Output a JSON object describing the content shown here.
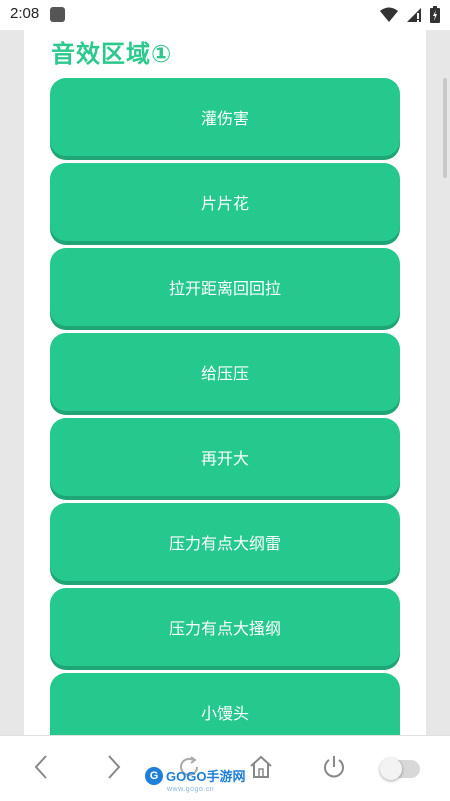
{
  "status_bar": {
    "time": "2:08",
    "icons": [
      "app-notification-icon",
      "wifi-icon",
      "signal-icon",
      "battery-icon"
    ]
  },
  "page": {
    "section_title": "音效区域①",
    "buttons": [
      {
        "label": "灌伤害"
      },
      {
        "label": "片片花"
      },
      {
        "label": "拉开距离回回拉"
      },
      {
        "label": "给压压"
      },
      {
        "label": "再开大"
      },
      {
        "label": "压力有点大纲雷"
      },
      {
        "label": "压力有点大搔纲"
      },
      {
        "label": "小馒头"
      }
    ]
  },
  "nav_bar": {
    "items": [
      "back-icon",
      "forward-icon",
      "refresh-icon",
      "home-icon",
      "power-icon",
      "toggle-switch"
    ],
    "watermark": {
      "badge": "G",
      "text": "GOGO手游网",
      "sub": "www.gogo.cn"
    }
  },
  "colors": {
    "accent": "#25c98e",
    "accent_shadow": "#1fa576",
    "title": "#2bc98c"
  }
}
